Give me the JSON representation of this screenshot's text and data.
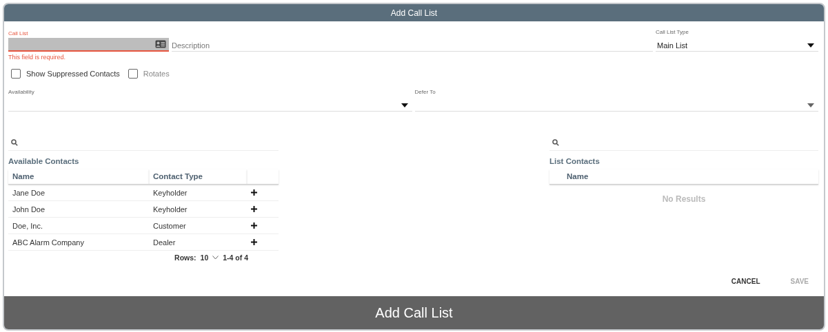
{
  "dialog": {
    "title": "Add Call List"
  },
  "call_list": {
    "label": "Call List",
    "error": "This field is required.",
    "invalid": true
  },
  "description": {
    "placeholder": "Description"
  },
  "call_list_type": {
    "label": "Call List Type",
    "value": "Main List"
  },
  "checkboxes": [
    {
      "label": "Show Suppressed Contacts",
      "checked": false,
      "disabled": false
    },
    {
      "label": "Rotates",
      "checked": false,
      "disabled": true
    }
  ],
  "availability": {
    "label": "Availability",
    "disabled": false
  },
  "defer_to": {
    "label": "Defer To",
    "disabled": true
  },
  "available_contacts": {
    "title": "Available Contacts",
    "columns": [
      "Name",
      "Contact Type"
    ],
    "rows": [
      [
        "Jane Doe",
        "Keyholder"
      ],
      [
        "John Doe",
        "Keyholder"
      ],
      [
        "Doe, Inc.",
        "Customer"
      ],
      [
        "ABC Alarm Company",
        "Dealer"
      ]
    ],
    "pagination": {
      "rows_label": "Rows:",
      "rows_value": "10",
      "range": "1-4 of 4"
    }
  },
  "list_contacts": {
    "title": "List Contacts",
    "columns": [
      "Name"
    ],
    "empty": "No Results"
  },
  "buttons": [
    {
      "label": "CANCEL",
      "disabled": false
    },
    {
      "label": "SAVE",
      "disabled": true
    }
  ],
  "footer": {
    "title": "Add Call List"
  }
}
